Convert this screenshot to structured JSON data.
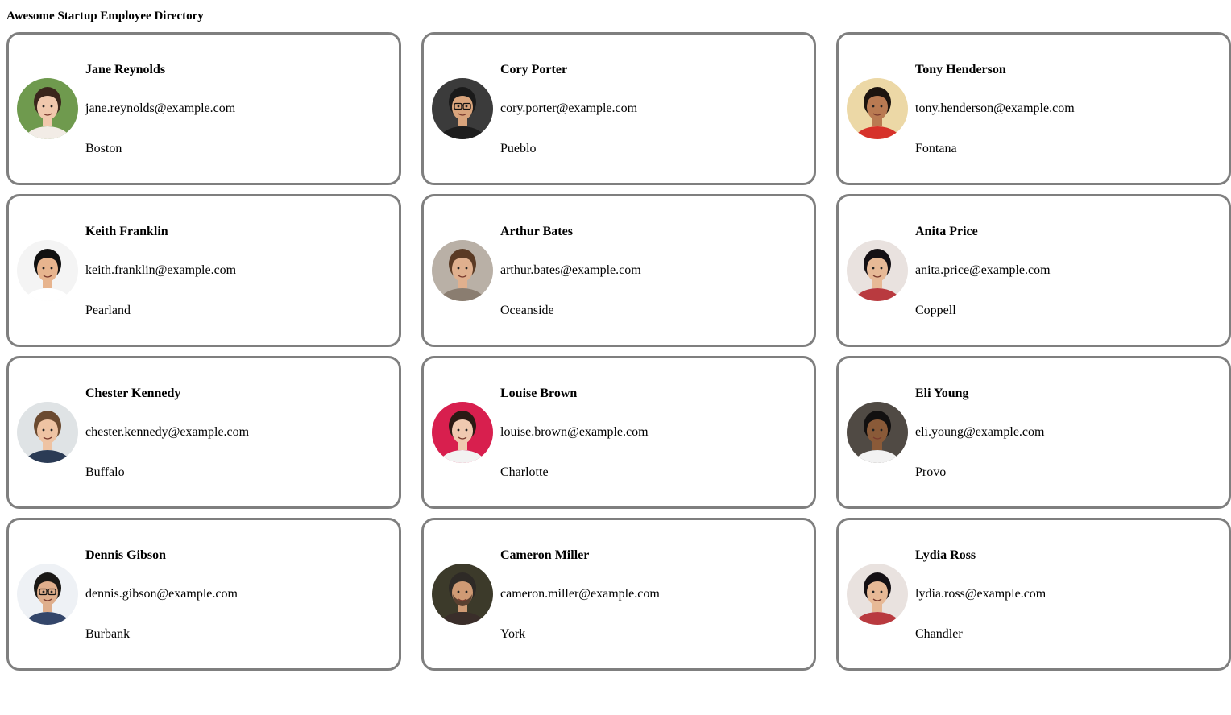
{
  "page": {
    "title": "Awesome Startup Employee Directory"
  },
  "employees": [
    {
      "name": "Jane Reynolds",
      "email": "jane.reynolds@example.com",
      "city": "Boston",
      "avatar": {
        "bg": "#6f9a4e",
        "skin": "#f0c8ad",
        "hair": "#3a261c",
        "shirt": "#f2ece6"
      }
    },
    {
      "name": "Cory Porter",
      "email": "cory.porter@example.com",
      "city": "Pueblo",
      "avatar": {
        "bg": "#3b3b3b",
        "skin": "#d9a47c",
        "hair": "#1a1a1a",
        "shirt": "#1d1d1d",
        "glasses": true
      }
    },
    {
      "name": "Tony Henderson",
      "email": "tony.henderson@example.com",
      "city": "Fontana",
      "avatar": {
        "bg": "#ecd8a6",
        "skin": "#b97a52",
        "hair": "#1c140f",
        "shirt": "#d6322a"
      }
    },
    {
      "name": "Keith Franklin",
      "email": "keith.franklin@example.com",
      "city": "Pearland",
      "avatar": {
        "bg": "#f4f4f4",
        "skin": "#e7b48e",
        "hair": "#111111",
        "shirt": "#ffffff"
      }
    },
    {
      "name": "Arthur Bates",
      "email": "arthur.bates@example.com",
      "city": "Oceanside",
      "avatar": {
        "bg": "#b9b0a6",
        "skin": "#e0b08e",
        "hair": "#5a3a24",
        "shirt": "#8a7d70"
      }
    },
    {
      "name": "Anita Price",
      "email": "anita.price@example.com",
      "city": "Coppell",
      "avatar": {
        "bg": "#e9e2df",
        "skin": "#e7b996",
        "hair": "#141014",
        "shirt": "#b93a3f"
      }
    },
    {
      "name": "Chester Kennedy",
      "email": "chester.kennedy@example.com",
      "city": "Buffalo",
      "avatar": {
        "bg": "#dfe3e5",
        "skin": "#eec3a3",
        "hair": "#6b4a30",
        "shirt": "#2b3b55"
      }
    },
    {
      "name": "Louise Brown",
      "email": "louise.brown@example.com",
      "city": "Charlotte",
      "avatar": {
        "bg": "#d81f4e",
        "skin": "#f0c9b0",
        "hair": "#2a1a14",
        "shirt": "#f2f2f2"
      }
    },
    {
      "name": "Eli Young",
      "email": "eli.young@example.com",
      "city": "Provo",
      "avatar": {
        "bg": "#504a44",
        "skin": "#8a5a38",
        "hair": "#121010",
        "shirt": "#f2f2f2"
      }
    },
    {
      "name": "Dennis Gibson",
      "email": "dennis.gibson@example.com",
      "city": "Burbank",
      "avatar": {
        "bg": "#eef1f5",
        "skin": "#dfae8c",
        "hair": "#1a1816",
        "shirt": "#34466a",
        "glasses": true
      }
    },
    {
      "name": "Cameron Miller",
      "email": "cameron.miller@example.com",
      "city": "York",
      "avatar": {
        "bg": "#3c3a2a",
        "skin": "#cf9a74",
        "hair": "#2e2a26",
        "shirt": "#3a2e2a",
        "beard": true
      }
    },
    {
      "name": "Lydia Ross",
      "email": "lydia.ross@example.com",
      "city": "Chandler",
      "avatar": {
        "bg": "#e9e2df",
        "skin": "#e7b996",
        "hair": "#141014",
        "shirt": "#b93a3f"
      }
    }
  ]
}
